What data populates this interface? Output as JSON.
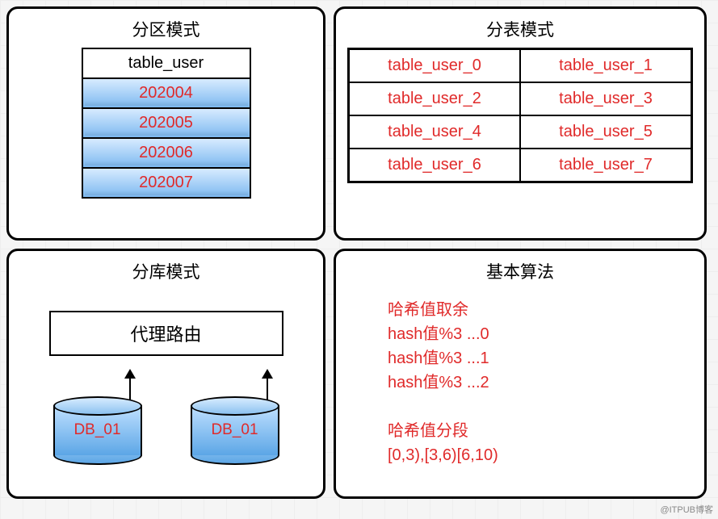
{
  "panel1": {
    "title": "分区模式",
    "table_name": "table_user",
    "partitions": [
      "202004",
      "202005",
      "202006",
      "202007"
    ]
  },
  "panel2": {
    "title": "分表模式",
    "tables": [
      "table_user_0",
      "table_user_1",
      "table_user_2",
      "table_user_3",
      "table_user_4",
      "table_user_5",
      "table_user_6",
      "table_user_7"
    ]
  },
  "panel3": {
    "title": "分库模式",
    "proxy_label": "代理路由",
    "databases": [
      "DB_01",
      "DB_01"
    ]
  },
  "panel4": {
    "title": "基本算法",
    "lines": [
      "哈希值取余",
      "hash值%3 ...0",
      "hash值%3 ...1",
      "hash值%3 ...2",
      "",
      "哈希值分段",
      "[0,3),[3,6)[6,10)"
    ]
  },
  "watermark": "@ITPUB博客"
}
